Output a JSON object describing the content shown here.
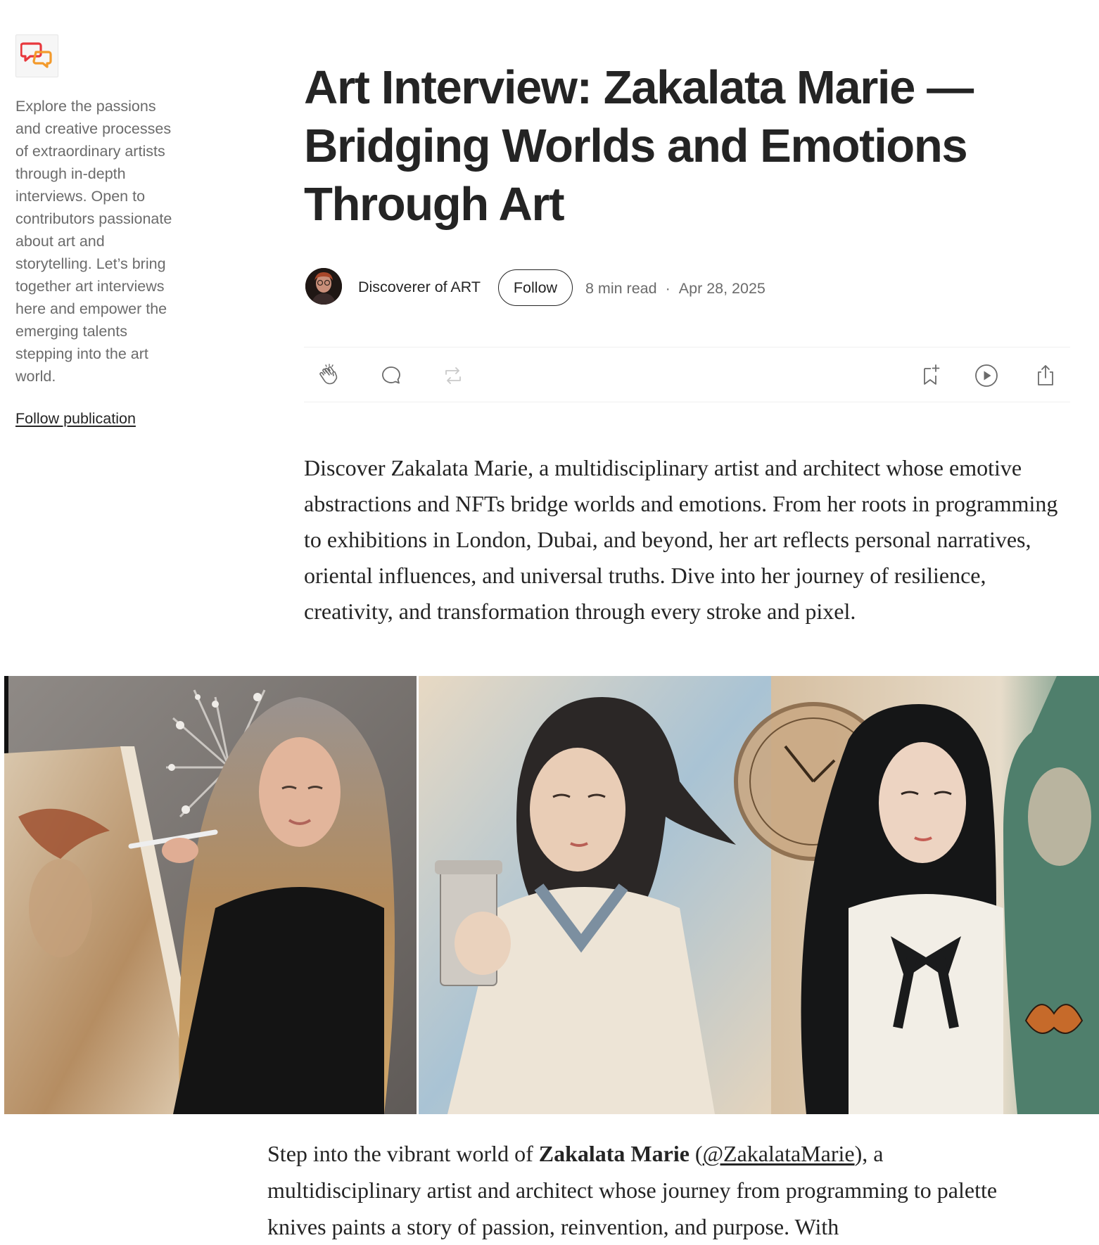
{
  "sidebar": {
    "logo_icon": "speech-bubbles-icon",
    "description": "Explore the passions and creative processes of extraordinary artists through in-depth interviews. Open to contributors passionate about art and storytelling. Let’s bring together art interviews here and empower the emerging talents stepping into the art world.",
    "follow_publication": "Follow publication"
  },
  "article": {
    "title": "Art Interview: Zakalata Marie — Bridging Worlds and Emotions Through Art",
    "author": "Discoverer of ART",
    "follow_label": "Follow",
    "read_time": "8 min read",
    "separator": "·",
    "date": "Apr 28, 2025",
    "intro": "Discover Zakalata Marie, a multidisciplinary artist and architect whose emotive abstractions and NFTs bridge worlds and emotions. From her roots in programming to exhibitions in London, Dubai, and beyond, her art reflects personal narratives, oriental influences, and universal truths. Dive into her journey of resilience, creativity, and transformation through every stroke and pixel.",
    "body": {
      "part1": "Step into the vibrant world of ",
      "bold_name": "Zakalata Marie",
      "part2": " (",
      "handle": "@ZakalataMarie",
      "part3": "), a multidisciplinary artist and architect whose journey from programming to palette knives paints a story of passion, reinvention, and purpose. With"
    }
  },
  "actions": {
    "clap_icon": "clap-icon",
    "comment_icon": "comment-icon",
    "repost_icon": "repost-icon",
    "bookmark_icon": "bookmark-add-icon",
    "listen_icon": "play-icon",
    "share_icon": "share-icon"
  },
  "colors": {
    "text": "#242424",
    "muted": "#6b6b6b",
    "logo_red": "#e8383d",
    "logo_orange": "#f39a2b"
  }
}
